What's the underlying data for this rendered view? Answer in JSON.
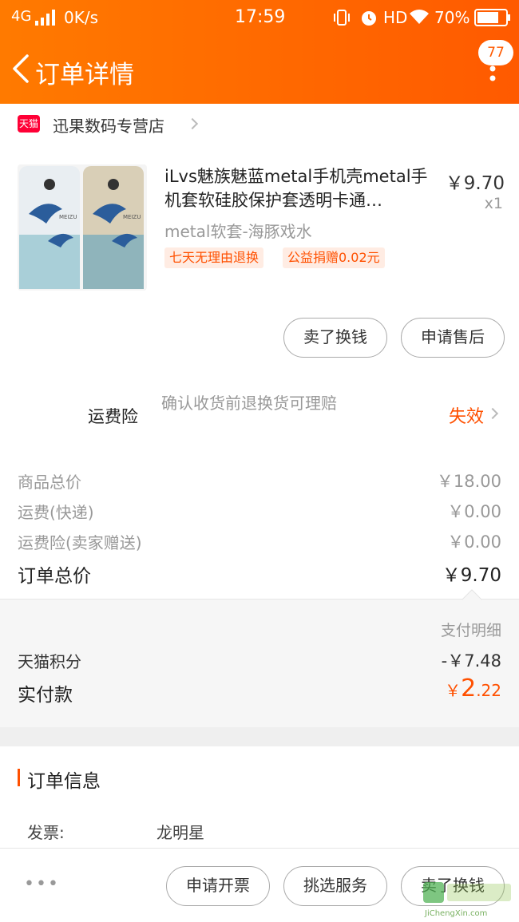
{
  "status_bar": {
    "signal": "4G",
    "speed": "0K/s",
    "time": "17:59",
    "hd": "HD",
    "battery": "70%"
  },
  "nav": {
    "title": "订单详情",
    "badge_count": "77"
  },
  "shop": {
    "badge": "天猫",
    "name": "迅果数码专营店"
  },
  "product": {
    "name": "iLvs魅族魅蓝metal手机壳metal手机套软硅胶保护套透明卡通…",
    "price": "￥9.70",
    "quantity": "x1",
    "sku": "metal软套-海豚戏水",
    "tags": [
      "七天无理由退换",
      "公益捐赠0.02元"
    ],
    "image_text": "MEIZU",
    "buttons": {
      "sell": "卖了换钱",
      "after_sale": "申请售后"
    }
  },
  "insurance": {
    "label": "运费险",
    "description": "确认收货前退换货可理赔",
    "status": "失效"
  },
  "summary": {
    "goods_total_label": "商品总价",
    "goods_total": "￥18.00",
    "shipping_label": "运费(快递)",
    "shipping": "￥0.00",
    "insurance_label": "运费险(卖家赠送)",
    "insurance": "￥0.00",
    "order_total_label": "订单总价",
    "order_total": "￥9.70"
  },
  "payment": {
    "detail_link": "支付明细",
    "points_label": "天猫积分",
    "points_value": "-￥7.48",
    "paid_label": "实付款",
    "paid_currency": "￥",
    "paid_int": "2",
    "paid_dec": ".22"
  },
  "order_info": {
    "title": "订单信息",
    "invoice_label": "发票:",
    "invoice_value": "龙明星"
  },
  "bottom_bar": {
    "more": "•••",
    "invoice_button": "申请开票",
    "service_button": "挑选服务",
    "sell_button": "卖了换钱"
  },
  "watermark": {
    "text": "JiChengXin.com"
  },
  "colors": {
    "brand_orange": "#ff6400",
    "accent_red": "#ff5000"
  }
}
